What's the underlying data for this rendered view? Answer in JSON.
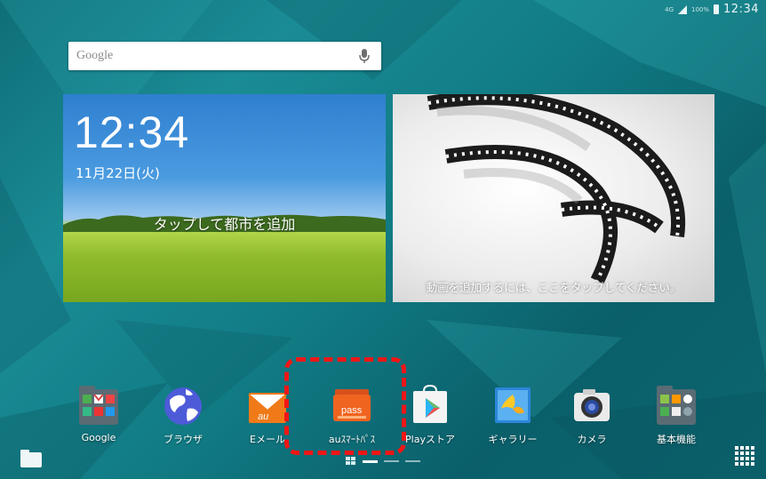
{
  "status": {
    "network": "4G",
    "battery": "100%",
    "time": "12:34"
  },
  "search": {
    "placeholder": "Google",
    "mic_icon": "mic-icon"
  },
  "weather_widget": {
    "time": "12:34",
    "date": "11月22日(火)",
    "add_city": "タップして都市を追加"
  },
  "video_widget": {
    "message": "動画を追加するには、ここをタップしてください。"
  },
  "dock": [
    {
      "label": "Google",
      "icon": "google-folder-icon"
    },
    {
      "label": "ブラウザ",
      "icon": "browser-globe-icon"
    },
    {
      "label": "Eメール",
      "icon": "au-email-icon"
    },
    {
      "label": "auｽﾏｰﾄﾊﾟｽ",
      "icon": "au-smartpass-icon"
    },
    {
      "label": "Playストア",
      "icon": "play-store-icon"
    },
    {
      "label": "ギャラリー",
      "icon": "gallery-icon"
    },
    {
      "label": "カメラ",
      "icon": "camera-icon"
    },
    {
      "label": "基本機能",
      "icon": "basic-functions-folder-icon"
    }
  ],
  "highlight_color": "#f01616",
  "page_indicator": {
    "pages": 3,
    "current": 1
  }
}
